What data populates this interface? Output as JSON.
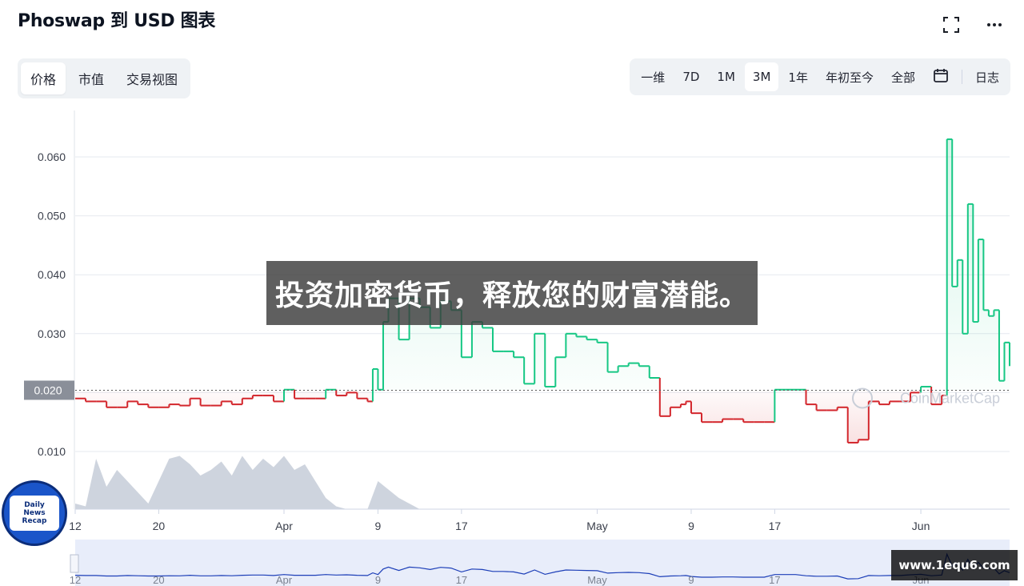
{
  "header": {
    "title": "Phoswap 到 USD 图表"
  },
  "top_icons": [
    "fullscreen-icon",
    "more-icon"
  ],
  "view_tabs": [
    {
      "label": "价格",
      "active": true
    },
    {
      "label": "市值",
      "active": false
    },
    {
      "label": "交易视图",
      "active": false
    }
  ],
  "range_tabs": [
    {
      "label": "一维",
      "active": false
    },
    {
      "label": "7D",
      "active": false
    },
    {
      "label": "1M",
      "active": false
    },
    {
      "label": "3M",
      "active": true
    },
    {
      "label": "1年",
      "active": false
    },
    {
      "label": "年初至今",
      "active": false
    },
    {
      "label": "全部",
      "active": false
    }
  ],
  "calendar_icon": "calendar-icon",
  "log_label": "日志",
  "banner": {
    "text": "投资加密货币，释放您的财富潜能。"
  },
  "badge": {
    "line1": "Daily",
    "line2": "News",
    "line3": "Recap"
  },
  "watermarks": {
    "chart": "CoinMarketCap",
    "url": "www.1equ6.com"
  },
  "colors": {
    "up": "#16c784",
    "down": "#d3262c",
    "volume": "#c6ccd8",
    "navigator": "#1d3fb8"
  },
  "chart_data": {
    "type": "line",
    "title": "Phoswap 到 USD 图表",
    "baseline": 0.0204,
    "baseline_label": "0.020",
    "ylim": [
      0.0005,
      0.068
    ],
    "y_ticks": [
      "0.010",
      "0.020",
      "0.030",
      "0.040",
      "0.050",
      "0.060"
    ],
    "y_tick_values": [
      0.01,
      0.02,
      0.03,
      0.04,
      0.05,
      0.06
    ],
    "x_ticks": [
      "12",
      "20",
      "Apr",
      "9",
      "17",
      "May",
      "9",
      "17",
      "Jun"
    ],
    "x_tick_days": [
      0,
      8,
      20,
      29,
      37,
      50,
      59,
      67,
      81
    ],
    "x_range_days": [
      0,
      89.5
    ],
    "x_unit": "days since Mar 12",
    "series": [
      {
        "x": [
          0,
          1,
          2,
          3,
          4,
          5,
          6,
          7,
          8,
          9,
          10,
          11,
          12,
          13,
          14,
          15,
          16,
          17,
          18,
          19,
          20,
          21,
          22,
          23,
          24,
          25,
          26,
          27,
          28,
          28.5,
          29,
          29.5,
          30,
          31,
          32,
          33,
          34,
          35,
          36,
          37,
          38,
          39,
          40,
          41,
          42,
          43,
          44,
          45,
          46,
          47,
          48,
          49,
          50,
          51,
          52,
          53,
          54,
          55,
          56,
          57,
          58,
          58.5,
          59,
          60,
          61,
          62,
          63,
          64,
          65,
          66,
          67,
          68,
          69,
          70,
          71,
          72,
          73,
          74,
          75,
          76,
          77,
          78,
          79,
          80,
          81,
          82,
          83,
          83.5,
          84,
          84.5,
          85,
          85.5,
          86,
          86.5,
          87,
          87.5,
          88,
          88.5,
          89,
          89.5
        ],
        "y": [
          0.019,
          0.0185,
          0.0185,
          0.0175,
          0.0175,
          0.0185,
          0.018,
          0.0175,
          0.0175,
          0.018,
          0.0178,
          0.019,
          0.0178,
          0.0178,
          0.0185,
          0.018,
          0.019,
          0.0195,
          0.0195,
          0.0185,
          0.0205,
          0.019,
          0.019,
          0.019,
          0.0205,
          0.0195,
          0.02,
          0.019,
          0.0185,
          0.024,
          0.0205,
          0.032,
          0.036,
          0.029,
          0.036,
          0.0345,
          0.031,
          0.0355,
          0.034,
          0.026,
          0.032,
          0.031,
          0.027,
          0.027,
          0.026,
          0.0215,
          0.03,
          0.021,
          0.026,
          0.03,
          0.0295,
          0.029,
          0.0285,
          0.0235,
          0.0245,
          0.025,
          0.0245,
          0.0225,
          0.016,
          0.0175,
          0.018,
          0.0185,
          0.0165,
          0.015,
          0.015,
          0.0155,
          0.0155,
          0.015,
          0.015,
          0.015,
          0.0205,
          0.0205,
          0.0205,
          0.018,
          0.017,
          0.017,
          0.0175,
          0.0115,
          0.012,
          0.0185,
          0.018,
          0.0185,
          0.0185,
          0.02,
          0.021,
          0.018,
          0.0195,
          0.063,
          0.038,
          0.0425,
          0.03,
          0.052,
          0.032,
          0.046,
          0.034,
          0.033,
          0.034,
          0.022,
          0.0285,
          0.0245
        ]
      }
    ],
    "volume": {
      "x": [
        0,
        1,
        2,
        3,
        4,
        5,
        6,
        7,
        8,
        9,
        10,
        11,
        12,
        13,
        14,
        15,
        16,
        17,
        18,
        19,
        20,
        21,
        22,
        23,
        24,
        25,
        26,
        27,
        28,
        29,
        30,
        31,
        32,
        33,
        34,
        35
      ],
      "relative": [
        0.1,
        0.05,
        0.9,
        0.4,
        0.7,
        0.5,
        0.3,
        0.1,
        0.5,
        0.9,
        0.95,
        0.8,
        0.6,
        0.7,
        0.85,
        0.6,
        0.95,
        0.7,
        0.9,
        0.75,
        0.95,
        0.7,
        0.8,
        0.5,
        0.2,
        0.05,
        0.0,
        0.0,
        0.0,
        0.5,
        0.35,
        0.2,
        0.1,
        0.0,
        0.0,
        0.0
      ]
    },
    "navigator_x_ticks": [
      "12",
      "20",
      "Apr",
      "9",
      "17",
      "May",
      "9",
      "17",
      "Jun"
    ]
  }
}
